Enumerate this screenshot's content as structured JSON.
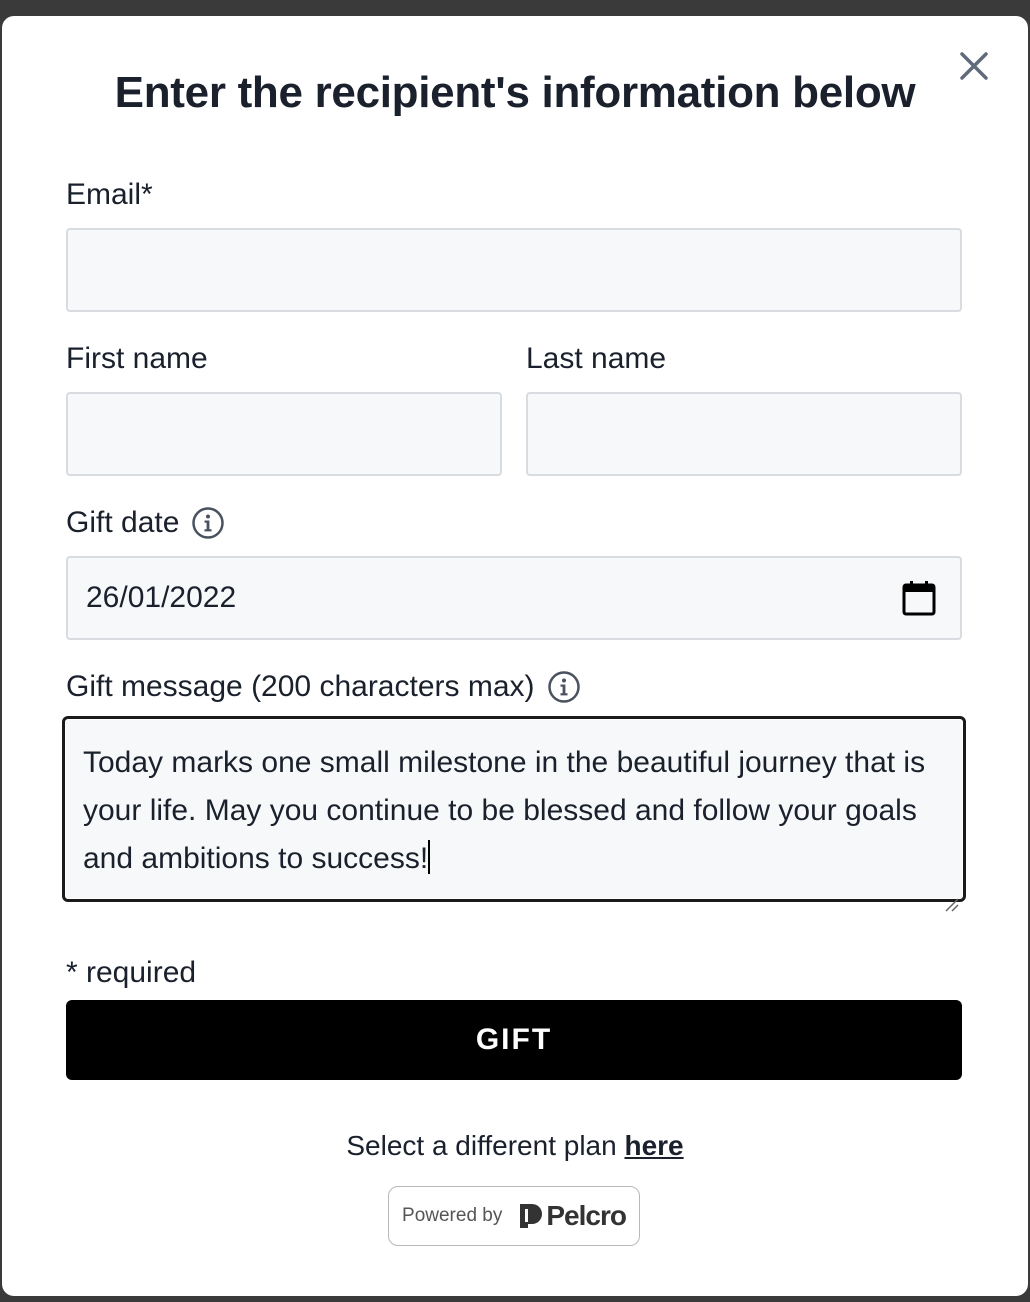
{
  "modal": {
    "title": "Enter the recipient's information below",
    "close_icon": "close-icon"
  },
  "form": {
    "email": {
      "label": "Email*",
      "value": "",
      "placeholder": ""
    },
    "first_name": {
      "label": "First name",
      "value": "",
      "placeholder": ""
    },
    "last_name": {
      "label": "Last name",
      "value": "",
      "placeholder": ""
    },
    "gift_date": {
      "label": "Gift date",
      "value": "26/01/2022",
      "icon": "calendar-icon",
      "info_icon": "info-icon"
    },
    "gift_message": {
      "label": "Gift message (200 characters max)",
      "value": "Today marks one small milestone in the beautiful journey that is your life. May you continue to be blessed and follow your goals and ambitions to success!",
      "info_icon": "info-icon"
    },
    "required_note": "* required",
    "submit_label": "GIFT"
  },
  "footer": {
    "select_plan_prefix": "Select a different plan ",
    "select_plan_link": "here",
    "powered_by": "Powered by",
    "brand": "Pelcro"
  },
  "colors": {
    "text": "#1a202c",
    "input_bg": "#f7f8fa",
    "input_border": "#d8dbe0",
    "button_bg": "#000000",
    "button_text": "#ffffff"
  }
}
